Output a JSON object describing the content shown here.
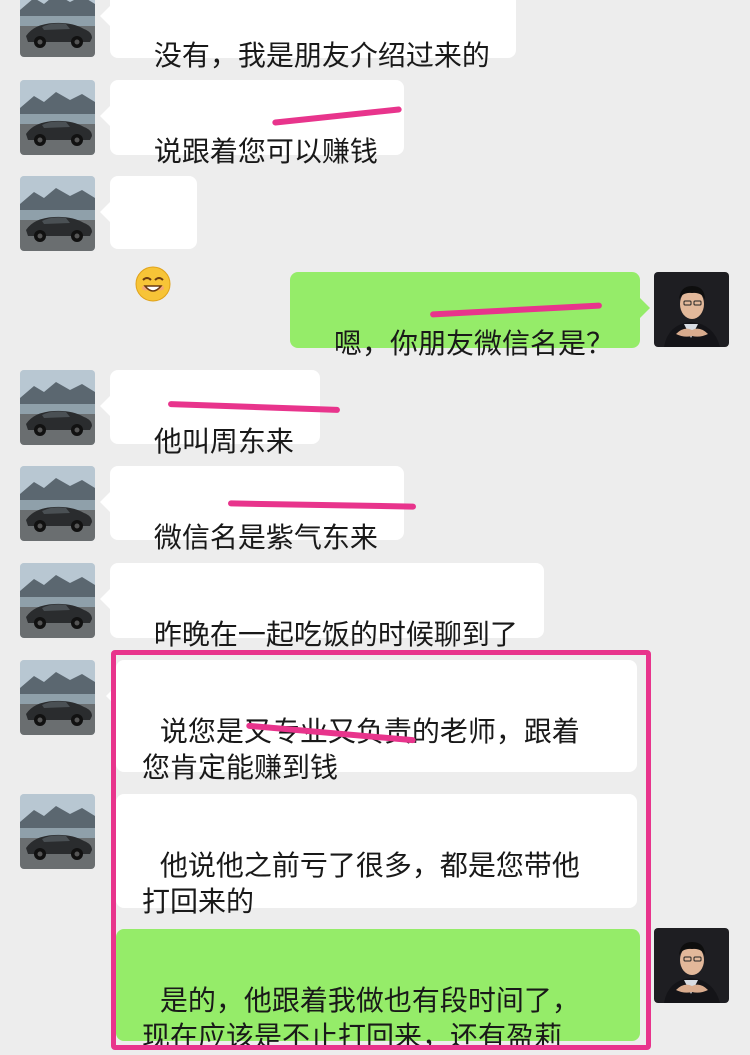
{
  "messages": [
    {
      "id": "m1",
      "side": "in",
      "text": "没有，我是朋友介绍过来的"
    },
    {
      "id": "m2",
      "side": "in",
      "text": "说跟着您可以赚钱"
    },
    {
      "id": "m3",
      "side": "in",
      "emoji": "grinning-face-emoji"
    },
    {
      "id": "m4",
      "side": "out",
      "text": "嗯，你朋友微信名是？"
    },
    {
      "id": "m5",
      "side": "in",
      "text": "他叫周东来"
    },
    {
      "id": "m6",
      "side": "in",
      "text": "微信名是紫气东来"
    },
    {
      "id": "m7",
      "side": "in",
      "text": "昨晚在一起吃饭的时候聊到了"
    },
    {
      "id": "m8",
      "side": "in",
      "text": "说您是又专业又负责的老师，跟着\n您肯定能赚到钱"
    },
    {
      "id": "m9",
      "side": "in",
      "text": "他说他之前亏了很多，都是您带他\n打回来的"
    },
    {
      "id": "m10",
      "side": "out",
      "text": "是的，他跟着我做也有段时间了，\n现在应该是不止打回来，还有盈莉"
    }
  ],
  "colors": {
    "background": "#ededed",
    "incoming_bubble": "#ffffff",
    "outgoing_bubble": "#95ec69",
    "annotation": "#e8348c"
  },
  "icons": {
    "contact_avatar": "sports-car-avatar",
    "self_avatar": "man-portrait-avatar"
  }
}
